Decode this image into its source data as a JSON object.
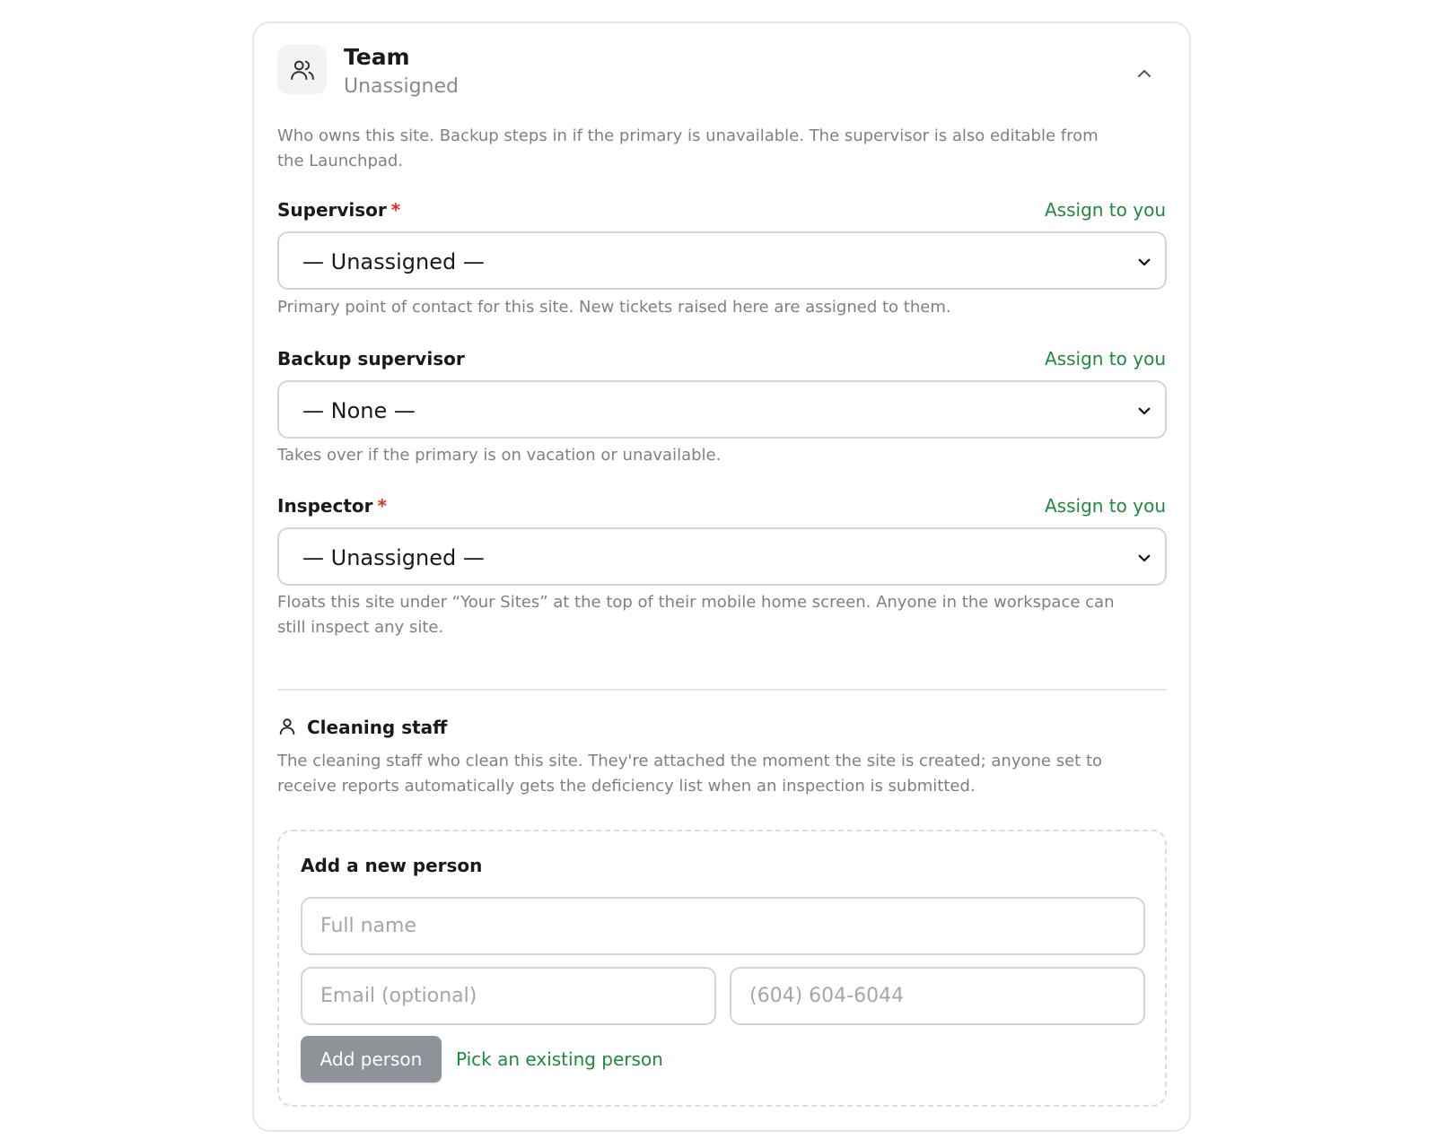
{
  "section": {
    "title": "Team",
    "subtitle": "Unassigned",
    "icon": "users-icon",
    "collapse_icon": "chevron-up-icon",
    "description": "Who owns this site. Backup steps in if the primary is unavailable. The supervisor is also editable from the Launchpad."
  },
  "fields": {
    "supervisor": {
      "label": "Supervisor",
      "required_mark": "*",
      "assign_link": "Assign to you",
      "value": "— Unassigned —",
      "help": "Primary point of contact for this site. New tickets raised here are assigned to them."
    },
    "backup": {
      "label": "Backup supervisor",
      "assign_link": "Assign to you",
      "value": "— None —",
      "help": "Takes over if the primary is on vacation or unavailable."
    },
    "inspector": {
      "label": "Inspector",
      "required_mark": "*",
      "assign_link": "Assign to you",
      "value": "— Unassigned —",
      "help": "Floats this site under “Your Sites” at the top of their mobile home screen. Anyone in the workspace can still inspect any site."
    }
  },
  "cleaning_staff": {
    "icon": "person-icon",
    "title": "Cleaning staff",
    "description": "The cleaning staff who clean this site. They're attached the moment the site is created; anyone set to receive reports automatically gets the deficiency list when an inspection is submitted.",
    "new_person": {
      "title": "Add a new person",
      "full_name_placeholder": "Full name",
      "email_placeholder": "Email (optional)",
      "phone_placeholder": "(604) 604-6044",
      "add_button": "Add person",
      "pick_existing_link": "Pick an existing person"
    }
  },
  "colors": {
    "accent_green": "#1e8a3c",
    "required_red": "#d93025",
    "disabled_button": "#8e9299"
  }
}
